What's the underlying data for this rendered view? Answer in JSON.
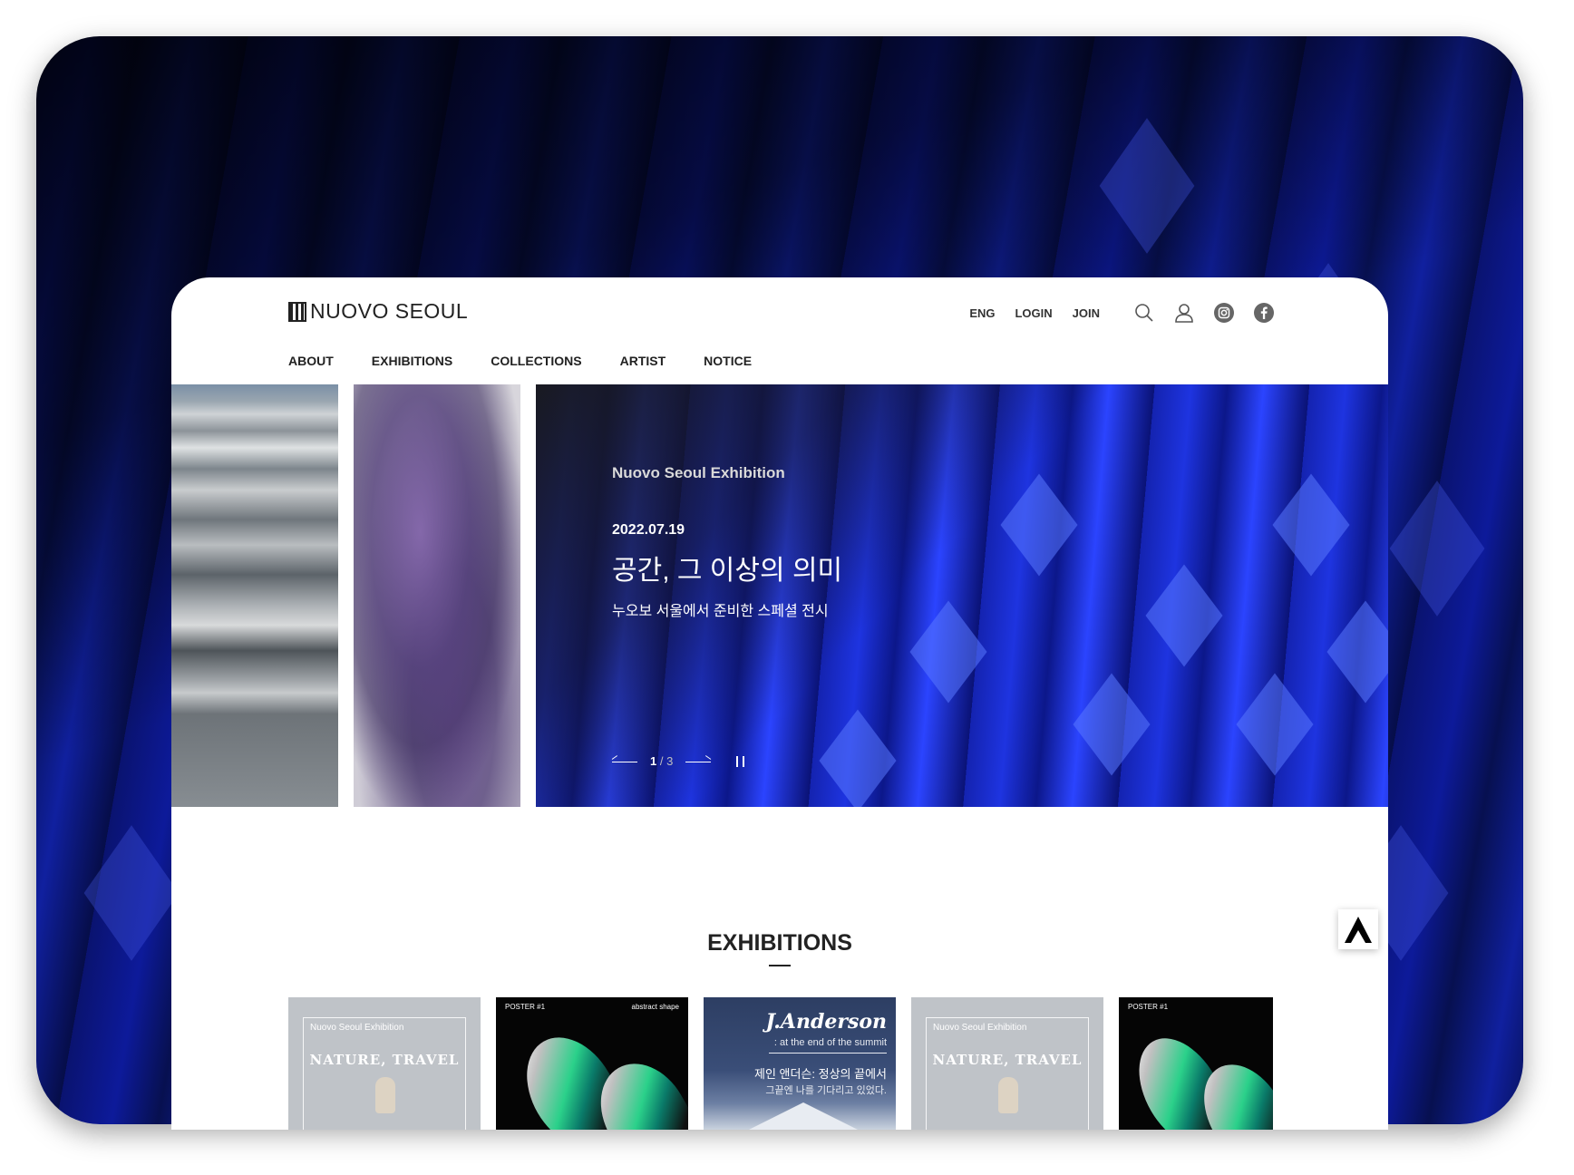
{
  "brand": {
    "name": "NUOVO SEOUL"
  },
  "util_links": [
    "ENG",
    "LOGIN",
    "JOIN"
  ],
  "icons": [
    "search-icon",
    "user-icon",
    "instagram-icon",
    "facebook-icon"
  ],
  "nav": [
    "ABOUT",
    "EXHIBITIONS",
    "COLLECTIONS",
    "ARTIST",
    "NOTICE"
  ],
  "hero": {
    "subtitle": "Nuovo Seoul Exhibition",
    "date": "2022.07.19",
    "title": "공간, 그 이상의 의미",
    "description": "누오보 서울에서 준비한 스페셜 전시",
    "current": "1",
    "separator": "/",
    "total": "3"
  },
  "exhibitions": {
    "heading": "EXHIBITIONS",
    "posters": [
      {
        "label": "Nuovo Seoul  Exhibition",
        "title": "NATURE, TRAVEL"
      },
      {
        "top_left": "POSTER #1",
        "top_right": "abstract shape"
      },
      {
        "name": "J.Anderson",
        "tagline": ": at the end of the summit",
        "ko_title": "제인 앤더슨: 정상의 끝에서",
        "ko_sub": "그끝엔 나를 기다리고 있었다."
      },
      {
        "label": "Nuovo Seoul  Exhibition",
        "title": "NATURE, TRAVEL"
      },
      {
        "top_left": "POSTER #1"
      }
    ]
  },
  "colors": {
    "accent_blue": "#1e34e0",
    "text_dark": "#222222"
  }
}
